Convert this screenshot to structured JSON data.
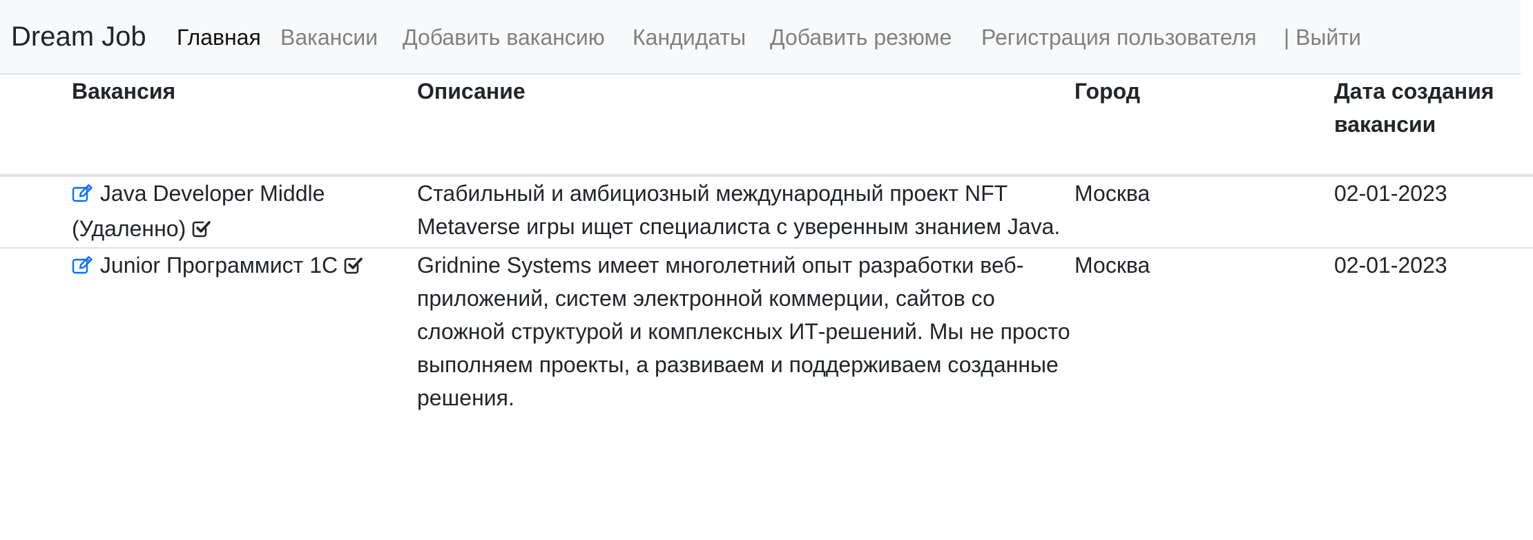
{
  "nav": {
    "brand": "Dream Job",
    "links": [
      {
        "label": "Главная",
        "active": true
      },
      {
        "label": "Вакансии",
        "active": false
      },
      {
        "label": "Добавить вакансию",
        "active": false
      },
      {
        "label": "Кандидаты",
        "active": false
      },
      {
        "label": "Добавить резюме",
        "active": false
      },
      {
        "label": "Регистрация пользователя",
        "active": false
      },
      {
        "label": "| Выйти",
        "active": false
      }
    ]
  },
  "table": {
    "headers": {
      "vacancy": "Вакансия",
      "description": "Описание",
      "city": "Город",
      "date": "Дата создания вакансии"
    },
    "rows": [
      {
        "title": "Java Developer Middle (Удаленно)",
        "description": "Стабильный и амбициозный международный проект NFT Metaverse игры ищет специалиста с уверенным знанием Java.",
        "city": "Москва",
        "date": "02-01-2023"
      },
      {
        "title": "Junior Программист 1С",
        "description": "Gridnine Systems имеет многолетний опыт разработки веб-приложений, систем электронной коммерции, сайтов со сложной структурой и комплексных ИТ-решений. Мы не просто выполняем проекты, а развиваем и поддерживаем созданные решения.",
        "city": "Москва",
        "date": "02-01-2023"
      }
    ]
  },
  "colors": {
    "navbar_bg": "#f8f9fa",
    "link_muted": "#808080",
    "link_active": "#111111",
    "icon_blue": "#0d6efd",
    "border": "#dee2e6"
  },
  "icons": {
    "edit": "edit-square-icon",
    "check": "check-square-icon"
  }
}
